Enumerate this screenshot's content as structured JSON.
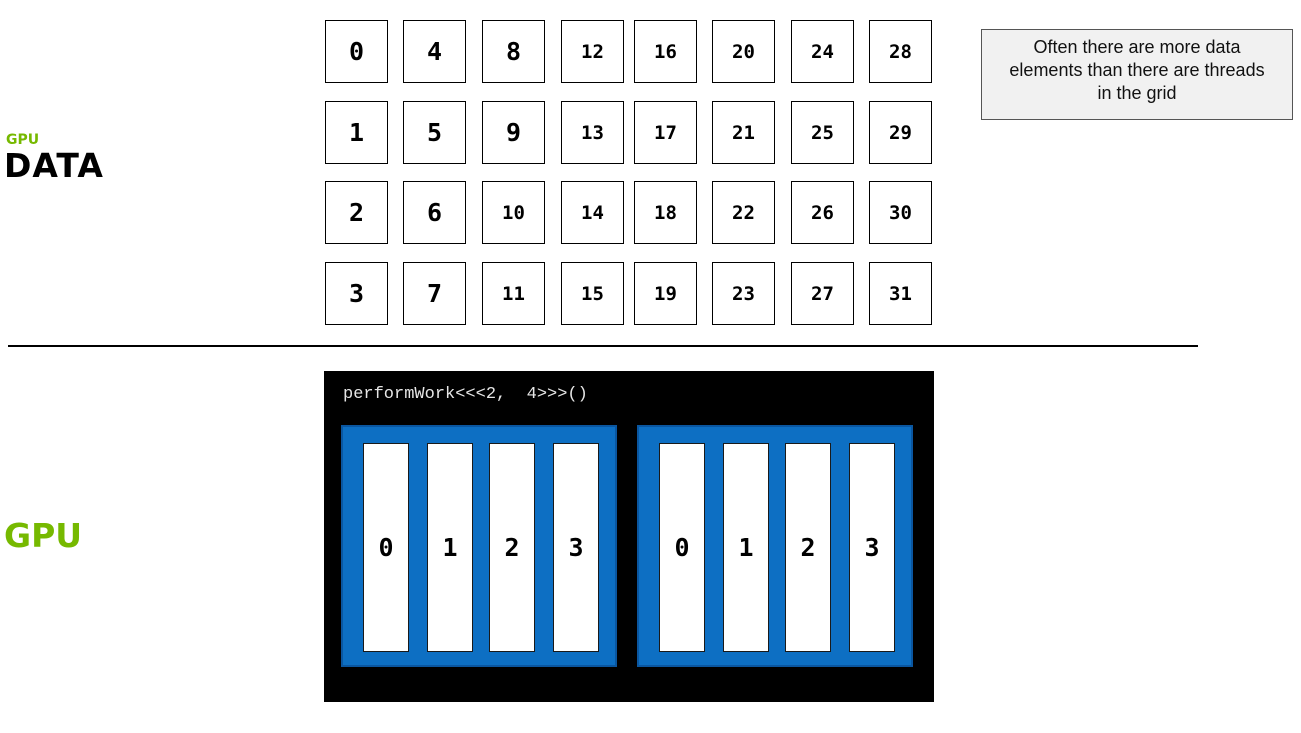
{
  "labels": {
    "gpu_small": "GPU",
    "data": "DATA",
    "gpu": "GPU"
  },
  "colors": {
    "accent_green": "#76b900",
    "block_blue": "#0d6fc3",
    "panel_black": "#000000"
  },
  "data_elements": [
    [
      "0",
      "4",
      "8",
      "12",
      "16",
      "20",
      "24",
      "28"
    ],
    [
      "1",
      "5",
      "9",
      "13",
      "17",
      "21",
      "25",
      "29"
    ],
    [
      "2",
      "6",
      "10",
      "14",
      "18",
      "22",
      "26",
      "30"
    ],
    [
      "3",
      "7",
      "11",
      "15",
      "19",
      "23",
      "27",
      "31"
    ]
  ],
  "note": "Often there are more data elements than there are threads in the grid",
  "gpu_panel": {
    "code": "performWork<<<2,  4>>>()",
    "blocks": [
      {
        "threads": [
          "0",
          "1",
          "2",
          "3"
        ]
      },
      {
        "threads": [
          "0",
          "1",
          "2",
          "3"
        ]
      }
    ]
  }
}
